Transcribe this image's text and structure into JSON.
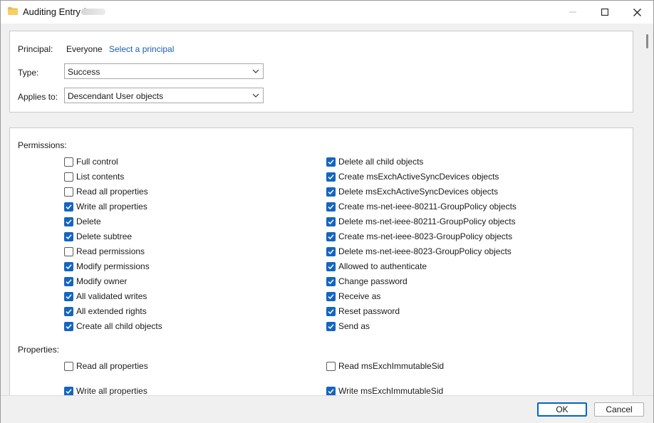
{
  "window": {
    "title": "Auditing Entry for"
  },
  "principal": {
    "label": "Principal:",
    "value": "Everyone",
    "link": "Select a principal"
  },
  "type": {
    "label": "Type:",
    "value": "Success"
  },
  "applies_to": {
    "label": "Applies to:",
    "value": "Descendant User objects"
  },
  "permissions": {
    "label": "Permissions:",
    "left": [
      {
        "label": "Full control",
        "checked": false
      },
      {
        "label": "List contents",
        "checked": false
      },
      {
        "label": "Read all properties",
        "checked": false
      },
      {
        "label": "Write all properties",
        "checked": true
      },
      {
        "label": "Delete",
        "checked": true
      },
      {
        "label": "Delete subtree",
        "checked": true
      },
      {
        "label": "Read permissions",
        "checked": false
      },
      {
        "label": "Modify permissions",
        "checked": true
      },
      {
        "label": "Modify owner",
        "checked": true
      },
      {
        "label": "All validated writes",
        "checked": true
      },
      {
        "label": "All extended rights",
        "checked": true
      },
      {
        "label": "Create all child objects",
        "checked": true
      }
    ],
    "right": [
      {
        "label": "Delete all child objects",
        "checked": true
      },
      {
        "label": "Create msExchActiveSyncDevices objects",
        "checked": true
      },
      {
        "label": "Delete msExchActiveSyncDevices objects",
        "checked": true
      },
      {
        "label": "Create ms-net-ieee-80211-GroupPolicy objects",
        "checked": true
      },
      {
        "label": "Delete ms-net-ieee-80211-GroupPolicy objects",
        "checked": true
      },
      {
        "label": "Create ms-net-ieee-8023-GroupPolicy objects",
        "checked": true
      },
      {
        "label": "Delete ms-net-ieee-8023-GroupPolicy objects",
        "checked": true
      },
      {
        "label": "Allowed to authenticate",
        "checked": true
      },
      {
        "label": "Change password",
        "checked": true
      },
      {
        "label": "Receive as",
        "checked": true
      },
      {
        "label": "Reset password",
        "checked": true
      },
      {
        "label": "Send as",
        "checked": true
      }
    ]
  },
  "properties": {
    "label": "Properties:",
    "left": [
      {
        "label": "Read all properties",
        "checked": false
      },
      {
        "label": "Write all properties",
        "checked": true
      }
    ],
    "right": [
      {
        "label": "Read msExchImmutableSid",
        "checked": false
      },
      {
        "label": "Write msExchImmutableSid",
        "checked": true
      }
    ]
  },
  "buttons": {
    "ok": "OK",
    "cancel": "Cancel"
  },
  "colors": {
    "accent": "#1565c0",
    "link": "#1a5fb4"
  }
}
